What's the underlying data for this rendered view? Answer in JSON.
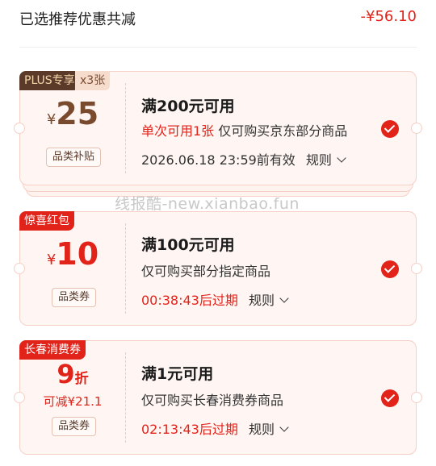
{
  "summary": {
    "label": "已选推荐优惠共减",
    "amount": "-¥56.10"
  },
  "watermark": "线报酷-new.xianbao.fun",
  "coupons": [
    {
      "tag": "PLUS专享",
      "count": "x3张",
      "currency": "¥",
      "value": "25",
      "category": "品类补贴",
      "title": "满200元可用",
      "limit": "单次可用1张",
      "desc": "仅可购买京东部分商品",
      "expiry": "2026.06.18 23:59前有效",
      "rule": "规则",
      "selected": true
    },
    {
      "tag": "惊喜红包",
      "currency": "¥",
      "value": "10",
      "category": "品类券",
      "title": "满100元可用",
      "desc": "仅可购买部分指定商品",
      "expiry": "00:38:43后过期",
      "rule": "规则",
      "selected": true
    },
    {
      "tag": "长春消费券",
      "value": "9",
      "unit": "折",
      "sub": "可减¥21.1",
      "category": "品类券",
      "title": "满1元可用",
      "desc": "仅可购买长春消费券商品",
      "expiry": "02:13:43后过期",
      "rule": "规则",
      "selected": true
    }
  ]
}
